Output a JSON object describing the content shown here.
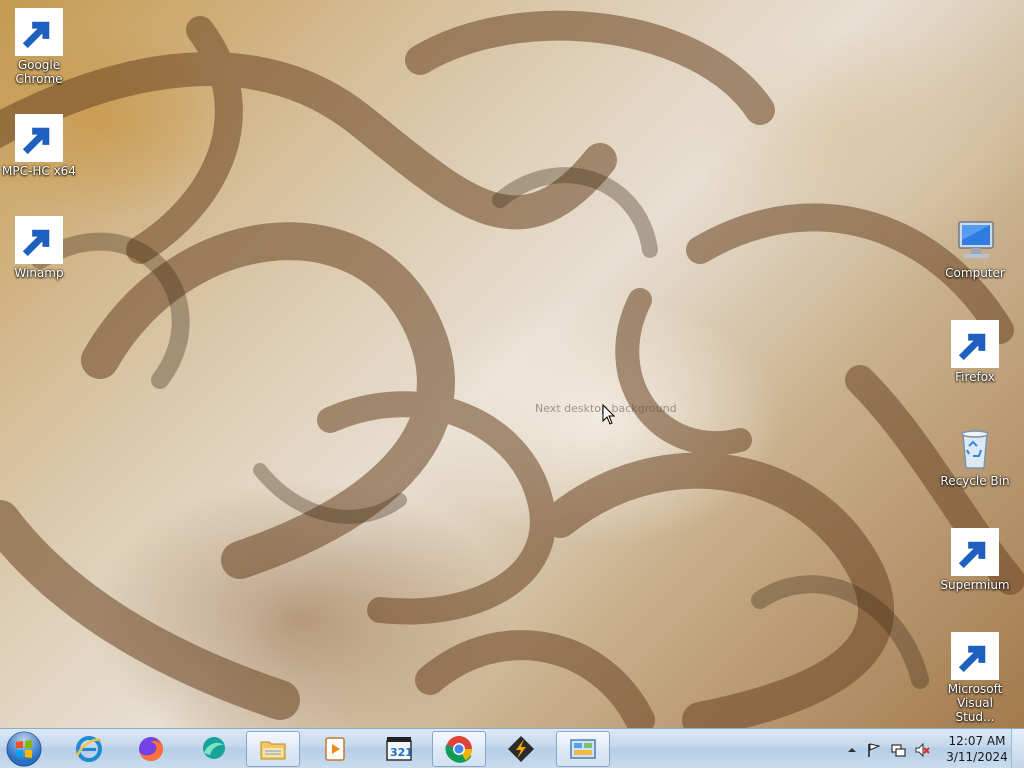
{
  "desktop": {
    "icons_left": [
      {
        "label": "Google Chrome",
        "icon": "chrome-icon"
      },
      {
        "label": "MPC-HC x64",
        "icon": "mpc-hc-icon"
      },
      {
        "label": "Winamp",
        "icon": "winamp-icon"
      }
    ],
    "icons_right": [
      {
        "label": "Computer",
        "icon": "computer-icon"
      },
      {
        "label": "Firefox",
        "icon": "firefox-icon"
      },
      {
        "label": "Recycle Bin",
        "icon": "recycle-bin-icon"
      },
      {
        "label": "Supermium",
        "icon": "supermium-icon"
      },
      {
        "label": "Microsoft Visual Stud...",
        "icon": "visual-studio-icon"
      }
    ],
    "hover_hint": "Next desktop background"
  },
  "taskbar": {
    "pinned": [
      {
        "name": "internet-explorer",
        "icon": "internet-explorer-icon"
      },
      {
        "name": "firefox",
        "icon": "firefox-icon"
      },
      {
        "name": "supermium",
        "icon": "supermium-icon"
      },
      {
        "name": "windows-explorer",
        "icon": "folder-icon"
      },
      {
        "name": "media-player",
        "icon": "media-player-icon"
      },
      {
        "name": "mpc-hc",
        "icon": "mpc-hc-icon"
      },
      {
        "name": "chrome",
        "icon": "chrome-icon"
      },
      {
        "name": "winamp",
        "icon": "winamp-icon"
      },
      {
        "name": "control-panel",
        "icon": "control-panel-icon"
      }
    ],
    "clock": {
      "time": "12:07 AM",
      "date": "3/11/2024"
    },
    "tray_icons": [
      "show-hidden-icons-icon",
      "action-center-flag-icon",
      "network-icon",
      "volume-muted-icon"
    ]
  },
  "colors": {
    "taskbar_top": "#dbe8f5",
    "taskbar_bottom": "#c9dcef",
    "label_text": "#ffffff"
  }
}
